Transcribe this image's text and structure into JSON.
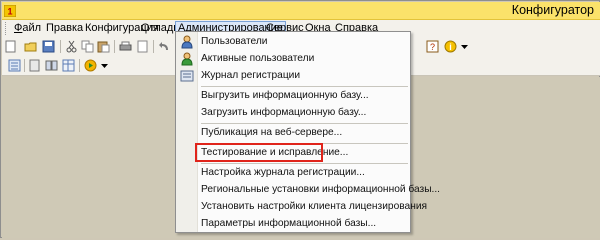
{
  "window": {
    "title": "Конфигуратор"
  },
  "menubar": {
    "items": [
      {
        "label": "Файл",
        "mnemonic": "Ф"
      },
      {
        "label": "Правка"
      },
      {
        "label": "Конфигурация"
      },
      {
        "label": "Отладка"
      },
      {
        "label": "Администрирование"
      },
      {
        "label": "Сервис"
      },
      {
        "label": "Окна"
      },
      {
        "label": "Справка"
      }
    ]
  },
  "dropdown": {
    "items": [
      {
        "label": "Пользователи",
        "icon": "user-icon"
      },
      {
        "label": "Активные пользователи",
        "icon": "active-users-icon"
      },
      {
        "label": "Журнал регистрации",
        "icon": "log-icon"
      },
      {
        "label": "Выгрузить информационную базу..."
      },
      {
        "label": "Загрузить информационную базу..."
      },
      {
        "label": "Публикация на веб-сервере..."
      },
      {
        "label": "Тестирование и исправление...",
        "highlighted": true
      },
      {
        "label": "Настройка журнала регистрации..."
      },
      {
        "label": "Региональные установки информационной базы..."
      },
      {
        "label": "Установить настройки клиента лицензирования"
      },
      {
        "label": "Параметры информационной базы..."
      }
    ],
    "highlight_color": "#e0241b"
  },
  "colors": {
    "titlebar": "#fbe26a",
    "workspace": "#cfc9b6",
    "menubar": "#f3f1eb"
  }
}
